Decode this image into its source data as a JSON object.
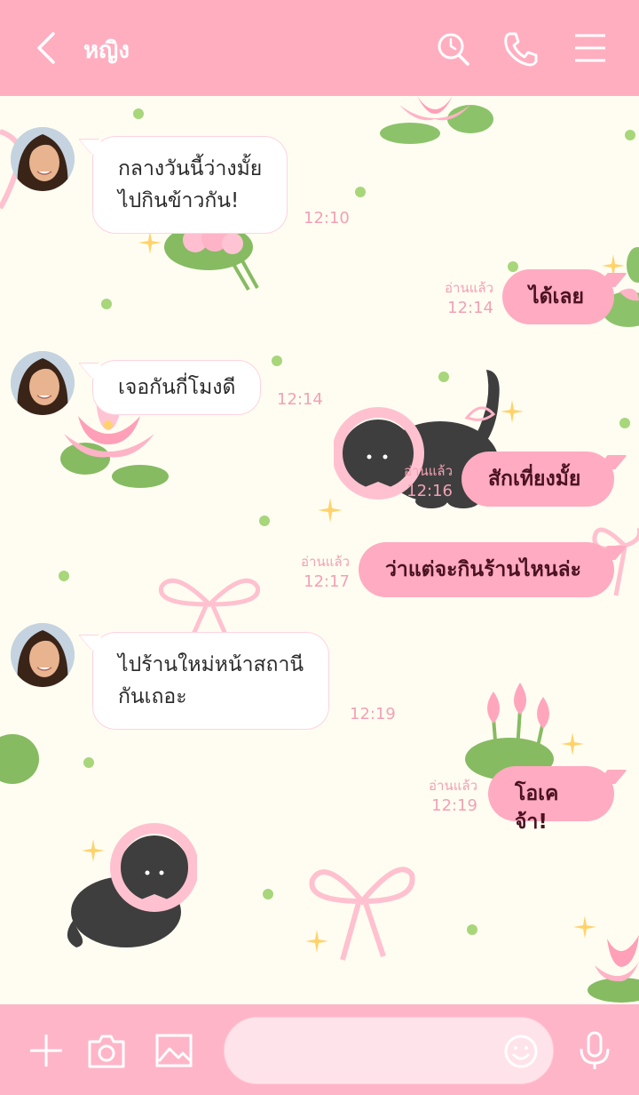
{
  "header": {
    "contact_name": "หญิง",
    "color": "#ffaec0"
  },
  "icons": {
    "back": "chevron-left-icon",
    "search": "search-icon",
    "call": "phone-icon",
    "menu": "hamburger-menu-icon",
    "add": "plus-icon",
    "camera": "camera-icon",
    "image": "image-icon",
    "emoji": "smiley-icon",
    "mic": "microphone-icon"
  },
  "messages": [
    {
      "from": "other",
      "lines": [
        "กลางวันนี้ว่างมั้ย",
        "ไปกินข้าวกัน!"
      ],
      "time": "12:10"
    },
    {
      "from": "me",
      "text": "ได้เลย",
      "read": "อ่านแล้ว",
      "time": "12:14"
    },
    {
      "from": "other",
      "lines": [
        "เจอกันกี่โมงดี"
      ],
      "time": "12:14"
    },
    {
      "from": "me",
      "text": "สักเที่ยงมั้ย",
      "read": "อ่านแล้ว",
      "time": "12:16"
    },
    {
      "from": "me",
      "text": "ว่าแต่จะกินร้านไหนล่ะ",
      "read": "อ่านแล้ว",
      "time": "12:17"
    },
    {
      "from": "other",
      "lines": [
        "ไปร้านใหม่หน้าสถานี",
        "กันเถอะ"
      ],
      "time": "12:19"
    },
    {
      "from": "me",
      "text": "โอเคจ้า!",
      "read": "อ่านแล้ว",
      "time": "12:19"
    }
  ],
  "composer": {
    "placeholder": ""
  },
  "colors": {
    "background": "#fffdf2",
    "outgoing_bubble": "#ffabc1",
    "accent": "#ffaec0"
  }
}
